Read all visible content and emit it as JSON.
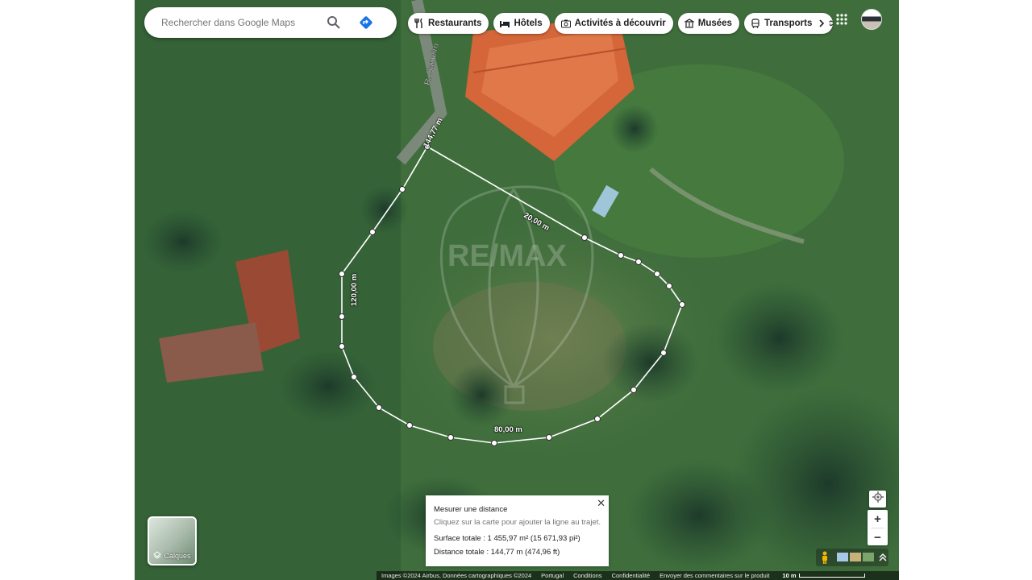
{
  "search": {
    "placeholder": "Rechercher dans Google Maps"
  },
  "chips": [
    {
      "icon": "restaurant-icon",
      "label": "Restaurants"
    },
    {
      "icon": "hotel-icon",
      "label": "Hôtels"
    },
    {
      "icon": "camera-icon",
      "label": "Activités à découvrir"
    },
    {
      "icon": "museum-icon",
      "label": "Musées"
    },
    {
      "icon": "transit-icon",
      "label": "Transports en commun"
    }
  ],
  "map": {
    "street_name": "R. Sameiro",
    "watermark": "RE/MAX",
    "measurements": {
      "segment_a": "144,77 m",
      "segment_b": "20,00 m",
      "segment_c": "120,00 m",
      "segment_d": "80,00 m"
    }
  },
  "measure_card": {
    "title": "Mesurer une distance",
    "hint": "Cliquez sur la carte pour ajouter la ligne au trajet.",
    "total_area": "Surface totale : 1 455,97 m² (15 671,93 pi²)",
    "total_distance": "Distance totale : 144,77 m (474,96 ft)"
  },
  "layers": {
    "label": "Calques"
  },
  "zoom": {
    "in": "+",
    "out": "−"
  },
  "attribution": {
    "imagery": "Images ©2024 Airbus, Données cartographiques ©2024",
    "country": "Portugal",
    "terms": "Conditions",
    "privacy": "Confidentialité",
    "feedback": "Envoyer des commentaires sur le produit",
    "scale": "10 m"
  }
}
